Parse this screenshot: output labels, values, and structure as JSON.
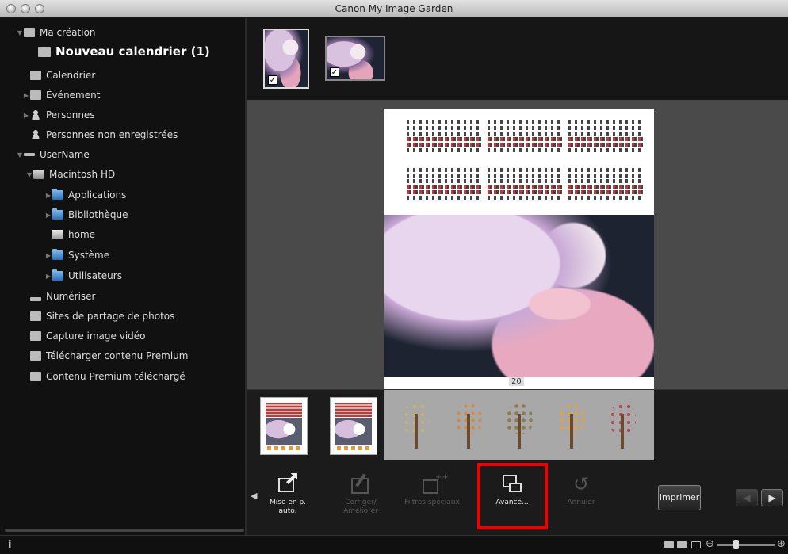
{
  "window": {
    "title": "Canon My Image Garden"
  },
  "sidebar": {
    "items": [
      {
        "label": "Ma création",
        "icon": "my-art-icon"
      },
      {
        "label": "Nouveau calendrier (1)",
        "icon": "calendar-item-icon"
      },
      {
        "label": "Calendrier",
        "icon": "calendar-icon"
      },
      {
        "label": "Événement",
        "icon": "event-icon"
      },
      {
        "label": "Personnes",
        "icon": "people-icon"
      },
      {
        "label": "Personnes non enregistrées",
        "icon": "unregistered-people-icon"
      },
      {
        "label": "UserName",
        "icon": "user-icon"
      },
      {
        "label": "Macintosh HD",
        "icon": "drive-icon"
      },
      {
        "label": "Applications",
        "icon": "folder-icon"
      },
      {
        "label": "Bibliothèque",
        "icon": "folder-icon"
      },
      {
        "label": "home",
        "icon": "home-icon"
      },
      {
        "label": "Système",
        "icon": "folder-icon"
      },
      {
        "label": "Utilisateurs",
        "icon": "folder-icon"
      },
      {
        "label": "Numériser",
        "icon": "scan-icon"
      },
      {
        "label": "Sites de partage de photos",
        "icon": "share-icon"
      },
      {
        "label": "Capture image vidéo",
        "icon": "video-capture-icon"
      },
      {
        "label": "Télécharger contenu Premium",
        "icon": "download-icon"
      },
      {
        "label": "Contenu Premium téléchargé",
        "icon": "downloaded-icon"
      }
    ]
  },
  "canvas": {
    "year_label": "20"
  },
  "toolbar": {
    "auto_layout": "Mise en p. auto.",
    "correct": "Corriger/ Améliorer",
    "filters": "Filtres spéciaux",
    "advanced": "Avancé...",
    "undo": "Annuler",
    "print": "Imprimer"
  },
  "status": {
    "info": "i"
  },
  "colors": {
    "highlight": "#e00000",
    "sidebar_bg": "#111111",
    "canvas_bg": "#4a4a4a"
  }
}
